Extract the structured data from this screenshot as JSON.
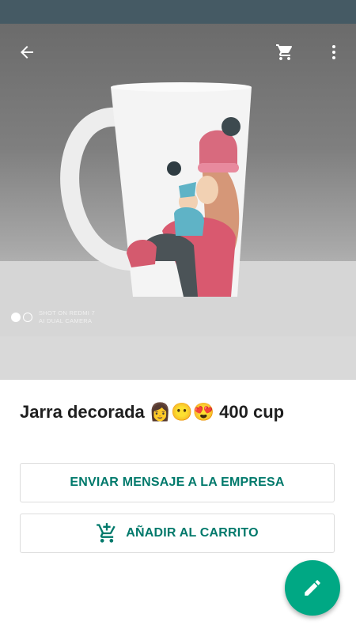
{
  "statusbar": {
    "color": "#455a64"
  },
  "toolbar": {
    "back_icon": "arrow-back-icon",
    "cart_icon": "cart-icon",
    "more_icon": "more-vert-icon"
  },
  "product": {
    "title": "Jarra decorada 👩😶😍 400 cup",
    "image": {
      "description_icon": "product-photo",
      "watermark_line1": "SHOT ON REDMI 7",
      "watermark_line2": "AI DUAL CAMERA"
    }
  },
  "actions": {
    "message_label": "ENVIAR MENSAJE A LA EMPRESA",
    "add_to_cart_label": "AÑADIR AL CARRITO",
    "add_to_cart_icon": "add-shopping-cart-icon"
  },
  "fab": {
    "icon": "pencil-icon"
  },
  "colors": {
    "accent": "#00796b",
    "fab": "#00a884"
  }
}
